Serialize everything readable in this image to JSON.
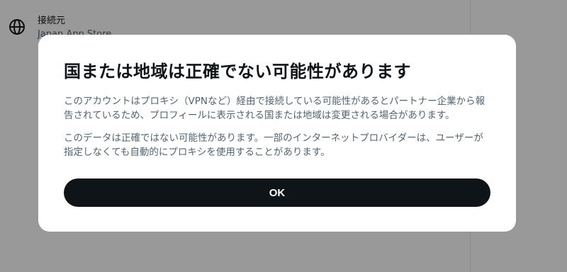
{
  "background": {
    "connection_label": "接続元",
    "connection_value": "Japan App Store",
    "icon": "globe-icon"
  },
  "dialog": {
    "title": "国または地域は正確でない可能性があります",
    "paragraph1": "このアカウントはプロキシ（VPNなど）経由で接続している可能性があるとパートナー企業から報告されているため、プロフィールに表示される国または地域は変更される場合があります。",
    "paragraph2": "このデータは正確ではない可能性があります。一部のインターネットプロバイダーは、ユーザーが指定しなくても自動的にプロキシを使用することがあります。",
    "ok_label": "OK"
  },
  "colors": {
    "overlay": "rgba(0,0,0,0.4)",
    "primary_text": "#0f1419",
    "secondary_text": "#536471",
    "button_bg": "#0f1419",
    "button_text": "#ffffff"
  }
}
